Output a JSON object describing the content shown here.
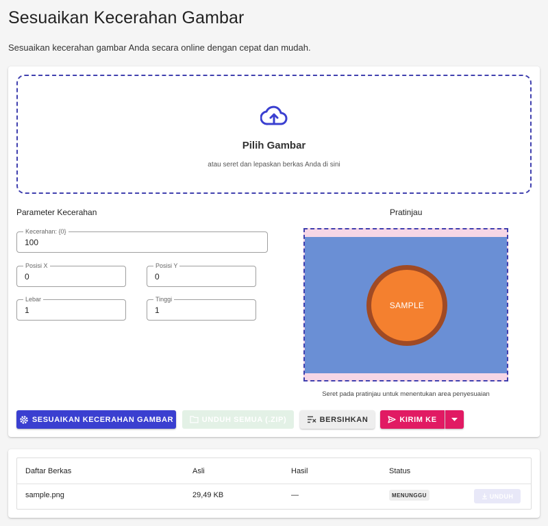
{
  "header": {
    "title": "Sesuaikan Kecerahan Gambar",
    "subtitle": "Sesuaikan kecerahan gambar Anda secara online dengan cepat dan mudah."
  },
  "dropzone": {
    "icon": "cloud-upload-icon",
    "title": "Pilih Gambar",
    "subtitle": "atau seret dan lepaskan berkas Anda di sini"
  },
  "params": {
    "title": "Parameter Kecerahan",
    "brightness": {
      "label": "Kecerahan: {0}",
      "value": "100"
    },
    "pos_x": {
      "label": "Posisi X",
      "value": "0"
    },
    "pos_y": {
      "label": "Posisi Y",
      "value": "0"
    },
    "width": {
      "label": "Lebar",
      "value": "1"
    },
    "height": {
      "label": "Tinggi",
      "value": "1"
    }
  },
  "preview": {
    "title": "Pratinjau",
    "sample_text": "SAMPLE",
    "hint": "Seret pada pratinjau untuk menentukan area penyesuaian"
  },
  "actions": {
    "adjust": "SESUAIKAN KECERAHAN GAMBAR",
    "download_all": "UNDUH SEMUA (.ZIP)",
    "clear": "BERSIHKAN",
    "send_to": "KIRIM KE"
  },
  "files": {
    "columns": [
      "Daftar Berkas",
      "Asli",
      "Hasil",
      "Status"
    ],
    "rows": [
      {
        "name": "sample.png",
        "original": "29,49 KB",
        "result": "—",
        "status": "MENUNGGU",
        "action": "UNDUH"
      }
    ]
  },
  "colors": {
    "primary": "#3a3fd0",
    "accent": "#e11a63",
    "dashed_border": "#3f3fae",
    "preview_bg": "#6a8fd5",
    "sample_circle": "#f4802f"
  }
}
